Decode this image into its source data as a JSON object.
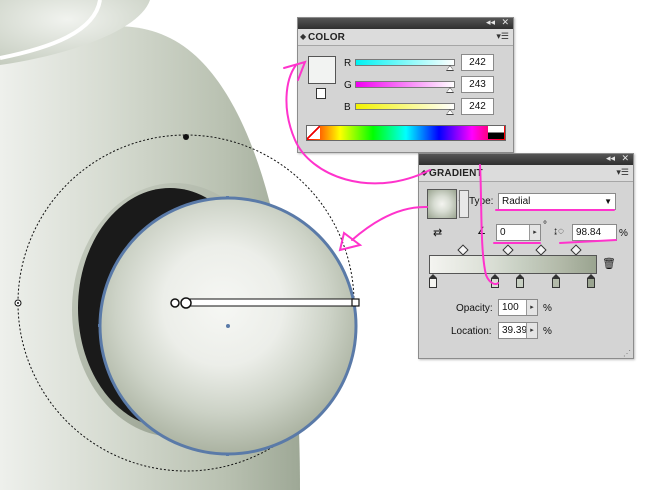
{
  "colors": {
    "annotation": "#ff33cc",
    "panel_bg": "#d4d4d4",
    "selection": "#5a7aa8",
    "illustration_base": "#b8c0b2"
  },
  "color_panel": {
    "title": "COLOR",
    "collapse_icon": "double-arrow-icon",
    "close_icon": "close-icon",
    "menu_icon": "panel-menu-icon",
    "channels": [
      {
        "label": "R",
        "value": "242",
        "level": 0.949
      },
      {
        "label": "G",
        "value": "243",
        "level": 0.953
      },
      {
        "label": "B",
        "value": "242",
        "level": 0.949
      }
    ],
    "fill_color": "#f2f3f2"
  },
  "gradient_panel": {
    "title": "GRADIENT",
    "type_label": "Type:",
    "type_value": "Radial",
    "angle_value": "0",
    "angle_unit": "°",
    "aspect_value": "98.84",
    "aspect_unit": "%",
    "opacity_label": "Opacity:",
    "opacity_value": "100",
    "opacity_unit": "%",
    "location_label": "Location:",
    "location_value": "39.39",
    "location_unit": "%",
    "stops": [
      {
        "color": "#f4f4f0",
        "location": 0.0
      },
      {
        "color": "#d8ddd3",
        "location": 0.39
      },
      {
        "color": "#c7cfc2",
        "location": 0.55
      },
      {
        "color": "#b3baa9",
        "location": 0.78
      },
      {
        "color": "#9aa490",
        "location": 1.0
      }
    ],
    "midpoints": [
      0.2,
      0.47,
      0.67,
      0.88
    ]
  }
}
